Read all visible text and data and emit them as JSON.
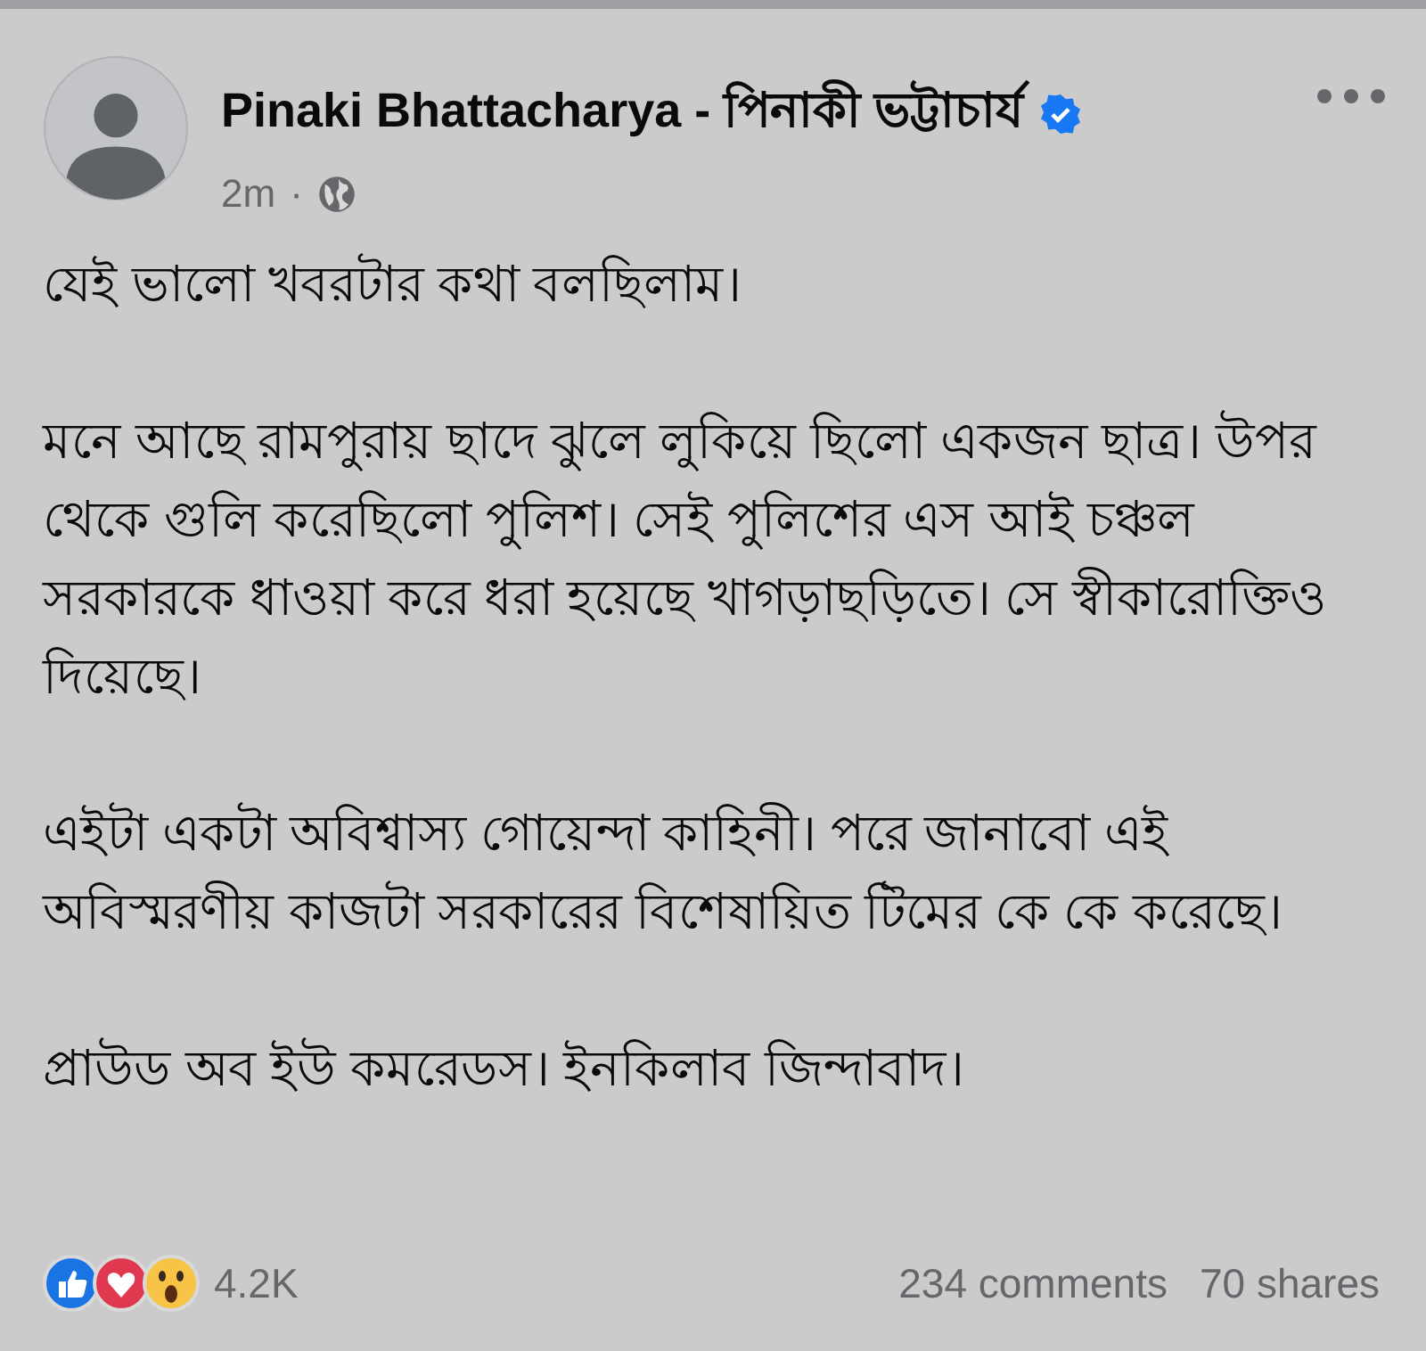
{
  "post": {
    "author": "Pinaki Bhattacharya - পিনাকী ভট্টাচার্য",
    "verified": true,
    "time": "2m",
    "separator": "·",
    "paragraphs": [
      "যেই ভালো খবরটার কথা বলছিলাম।",
      "মনে আছে রামপুরায় ছাদে ঝুলে লুকিয়ে ছিলো একজন ছাত্র। উপর থেকে গুলি করেছিলো পুলিশ। সেই পুলিশের এস আই চঞ্চল সরকারকে ধাওয়া করে ধরা হয়েছে খাগড়াছড়িতে। সে স্বীকারোক্তিও দিয়েছে।",
      "এইটা একটা অবিশ্বাস্য গোয়েন্দা কাহিনী। পরে জানাবো এই অবিস্মরণীয় কাজটা সরকারের বিশেষায়িত টিমের কে কে করেছে।",
      "প্রাউড অব ইউ কমরেডস। ইনকিলাব জিন্দাবাদ।"
    ]
  },
  "footer": {
    "reactions_count": "4.2K",
    "comments": "234 comments",
    "shares": "70 shares"
  }
}
